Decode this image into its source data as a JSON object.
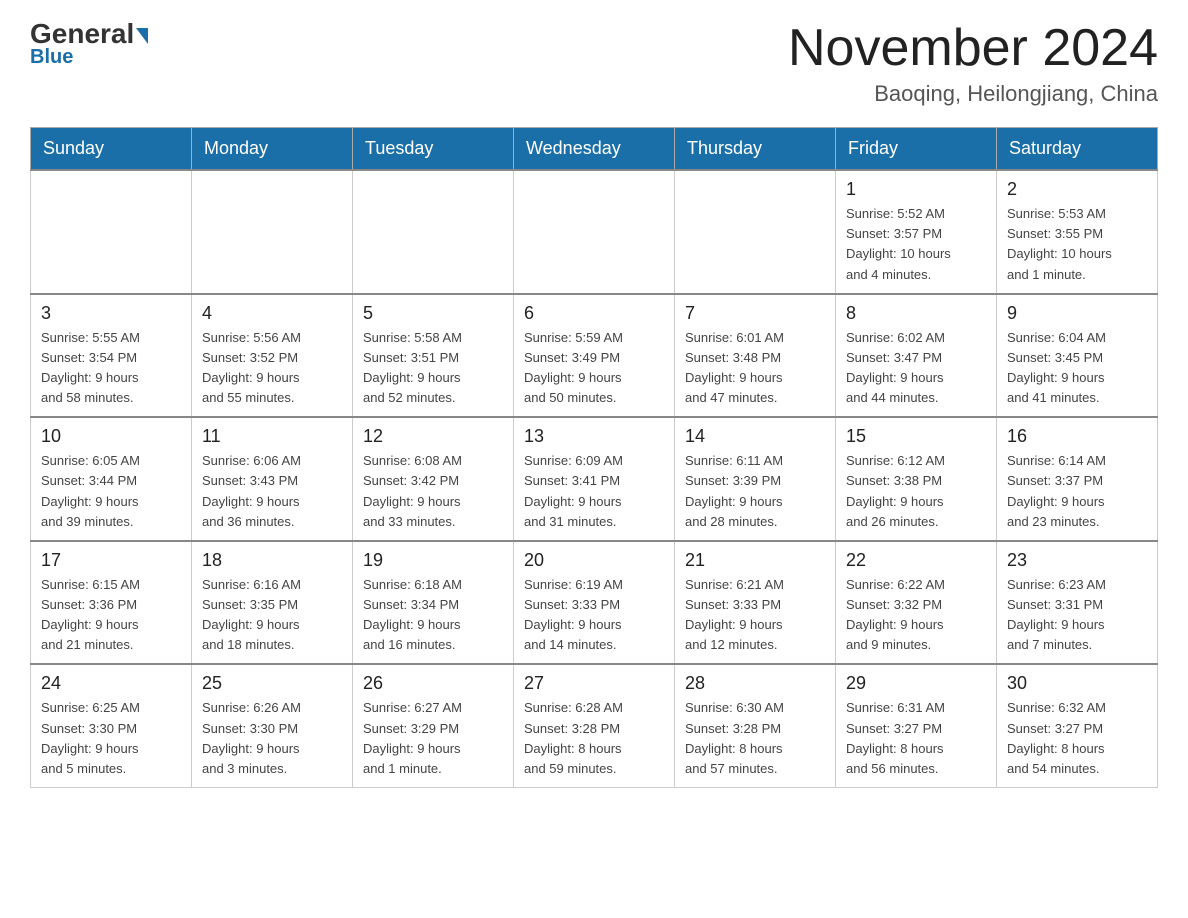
{
  "header": {
    "logo_general": "General",
    "logo_blue": "Blue",
    "month_title": "November 2024",
    "location": "Baoqing, Heilongjiang, China"
  },
  "days_of_week": [
    "Sunday",
    "Monday",
    "Tuesday",
    "Wednesday",
    "Thursday",
    "Friday",
    "Saturday"
  ],
  "weeks": [
    {
      "days": [
        {
          "number": "",
          "info": ""
        },
        {
          "number": "",
          "info": ""
        },
        {
          "number": "",
          "info": ""
        },
        {
          "number": "",
          "info": ""
        },
        {
          "number": "",
          "info": ""
        },
        {
          "number": "1",
          "info": "Sunrise: 5:52 AM\nSunset: 3:57 PM\nDaylight: 10 hours\nand 4 minutes."
        },
        {
          "number": "2",
          "info": "Sunrise: 5:53 AM\nSunset: 3:55 PM\nDaylight: 10 hours\nand 1 minute."
        }
      ]
    },
    {
      "days": [
        {
          "number": "3",
          "info": "Sunrise: 5:55 AM\nSunset: 3:54 PM\nDaylight: 9 hours\nand 58 minutes."
        },
        {
          "number": "4",
          "info": "Sunrise: 5:56 AM\nSunset: 3:52 PM\nDaylight: 9 hours\nand 55 minutes."
        },
        {
          "number": "5",
          "info": "Sunrise: 5:58 AM\nSunset: 3:51 PM\nDaylight: 9 hours\nand 52 minutes."
        },
        {
          "number": "6",
          "info": "Sunrise: 5:59 AM\nSunset: 3:49 PM\nDaylight: 9 hours\nand 50 minutes."
        },
        {
          "number": "7",
          "info": "Sunrise: 6:01 AM\nSunset: 3:48 PM\nDaylight: 9 hours\nand 47 minutes."
        },
        {
          "number": "8",
          "info": "Sunrise: 6:02 AM\nSunset: 3:47 PM\nDaylight: 9 hours\nand 44 minutes."
        },
        {
          "number": "9",
          "info": "Sunrise: 6:04 AM\nSunset: 3:45 PM\nDaylight: 9 hours\nand 41 minutes."
        }
      ]
    },
    {
      "days": [
        {
          "number": "10",
          "info": "Sunrise: 6:05 AM\nSunset: 3:44 PM\nDaylight: 9 hours\nand 39 minutes."
        },
        {
          "number": "11",
          "info": "Sunrise: 6:06 AM\nSunset: 3:43 PM\nDaylight: 9 hours\nand 36 minutes."
        },
        {
          "number": "12",
          "info": "Sunrise: 6:08 AM\nSunset: 3:42 PM\nDaylight: 9 hours\nand 33 minutes."
        },
        {
          "number": "13",
          "info": "Sunrise: 6:09 AM\nSunset: 3:41 PM\nDaylight: 9 hours\nand 31 minutes."
        },
        {
          "number": "14",
          "info": "Sunrise: 6:11 AM\nSunset: 3:39 PM\nDaylight: 9 hours\nand 28 minutes."
        },
        {
          "number": "15",
          "info": "Sunrise: 6:12 AM\nSunset: 3:38 PM\nDaylight: 9 hours\nand 26 minutes."
        },
        {
          "number": "16",
          "info": "Sunrise: 6:14 AM\nSunset: 3:37 PM\nDaylight: 9 hours\nand 23 minutes."
        }
      ]
    },
    {
      "days": [
        {
          "number": "17",
          "info": "Sunrise: 6:15 AM\nSunset: 3:36 PM\nDaylight: 9 hours\nand 21 minutes."
        },
        {
          "number": "18",
          "info": "Sunrise: 6:16 AM\nSunset: 3:35 PM\nDaylight: 9 hours\nand 18 minutes."
        },
        {
          "number": "19",
          "info": "Sunrise: 6:18 AM\nSunset: 3:34 PM\nDaylight: 9 hours\nand 16 minutes."
        },
        {
          "number": "20",
          "info": "Sunrise: 6:19 AM\nSunset: 3:33 PM\nDaylight: 9 hours\nand 14 minutes."
        },
        {
          "number": "21",
          "info": "Sunrise: 6:21 AM\nSunset: 3:33 PM\nDaylight: 9 hours\nand 12 minutes."
        },
        {
          "number": "22",
          "info": "Sunrise: 6:22 AM\nSunset: 3:32 PM\nDaylight: 9 hours\nand 9 minutes."
        },
        {
          "number": "23",
          "info": "Sunrise: 6:23 AM\nSunset: 3:31 PM\nDaylight: 9 hours\nand 7 minutes."
        }
      ]
    },
    {
      "days": [
        {
          "number": "24",
          "info": "Sunrise: 6:25 AM\nSunset: 3:30 PM\nDaylight: 9 hours\nand 5 minutes."
        },
        {
          "number": "25",
          "info": "Sunrise: 6:26 AM\nSunset: 3:30 PM\nDaylight: 9 hours\nand 3 minutes."
        },
        {
          "number": "26",
          "info": "Sunrise: 6:27 AM\nSunset: 3:29 PM\nDaylight: 9 hours\nand 1 minute."
        },
        {
          "number": "27",
          "info": "Sunrise: 6:28 AM\nSunset: 3:28 PM\nDaylight: 8 hours\nand 59 minutes."
        },
        {
          "number": "28",
          "info": "Sunrise: 6:30 AM\nSunset: 3:28 PM\nDaylight: 8 hours\nand 57 minutes."
        },
        {
          "number": "29",
          "info": "Sunrise: 6:31 AM\nSunset: 3:27 PM\nDaylight: 8 hours\nand 56 minutes."
        },
        {
          "number": "30",
          "info": "Sunrise: 6:32 AM\nSunset: 3:27 PM\nDaylight: 8 hours\nand 54 minutes."
        }
      ]
    }
  ]
}
